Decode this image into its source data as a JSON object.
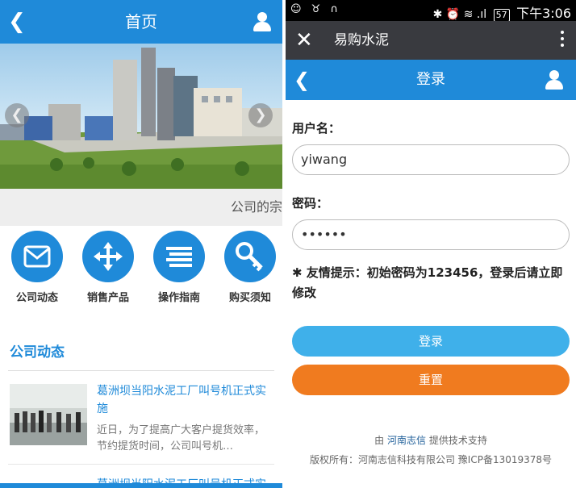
{
  "left": {
    "header": {
      "back_icon": "chevron-left-icon",
      "title": "首页",
      "user_icon": "user-icon"
    },
    "banner": {
      "prev_icon": "chevron-left-icon",
      "next_icon": "chevron-right-icon"
    },
    "ticker_text": "公司的宗",
    "shortcuts": [
      {
        "label": "公司动态",
        "icon": "mail-icon"
      },
      {
        "label": "销售产品",
        "icon": "move-arrows-icon"
      },
      {
        "label": "操作指南",
        "icon": "list-lines-icon"
      },
      {
        "label": "购买须知",
        "icon": "key-icon"
      }
    ],
    "section_title": "公司动态",
    "news": [
      {
        "title": "葛洲坝当阳水泥工厂叫号机正式实施",
        "desc": "近日，为了提高广大客户提货效率，节约提货时间，公司叫号机…"
      },
      {
        "title": "葛洲坝当阳水泥工厂叫号机正式实",
        "desc": ""
      }
    ]
  },
  "right": {
    "status_bar": {
      "left_icons": "☺ ♉ ∩",
      "right_icons": "✱ ⏰ ≋ .ıl",
      "battery": "57",
      "time": "下午3:06"
    },
    "wechat_bar": {
      "close_icon": "close-icon",
      "title": "易购水泥",
      "more_icon": "more-vertical-icon"
    },
    "login_header": {
      "title": "登录"
    },
    "form": {
      "username_label": "用户名：",
      "username_value": "yiwang",
      "password_label": "密码：",
      "password_value": "••••••",
      "hint": "✱ 友情提示：初始密码为123456，登录后请立即修改",
      "login_button": "登录",
      "reset_button": "重置"
    },
    "footer": {
      "support_prefix": "由",
      "support_brand": "河南志信",
      "support_suffix": "提供技术支持",
      "copyright": "版权所有：河南志信科技有限公司 豫ICP备13019378号"
    }
  },
  "colors": {
    "primary": "#1f8ad9",
    "login_button": "#3fb0ea",
    "reset_button": "#f07b1f",
    "wechat_bar": "#393a3f"
  }
}
